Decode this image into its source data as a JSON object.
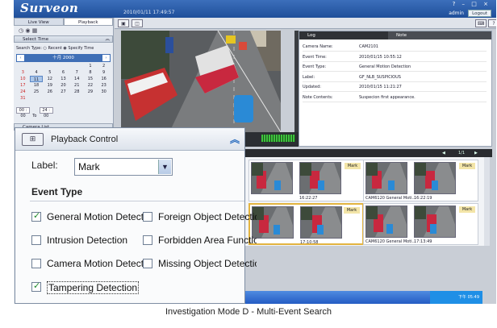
{
  "app": {
    "brand": "Surveon",
    "datetime": "2010/01/11 17:49:57",
    "user": "admin",
    "logout_label": "Logout",
    "window_controls": [
      "?",
      "–",
      "□",
      "×"
    ]
  },
  "sidebar": {
    "tabs": [
      {
        "label": "Live View",
        "active": false
      },
      {
        "label": "Playback",
        "active": true
      }
    ],
    "select_time_label": "Select Time",
    "search_type_label": "Search Type:",
    "search_options": [
      {
        "label": "Recent",
        "selected": false
      },
      {
        "label": "Specify Time",
        "selected": true
      }
    ],
    "calendar": {
      "month_label": "十月 2000",
      "selected_day": "11",
      "weeks": [
        [
          "",
          "",
          "",
          "",
          "",
          "1",
          "2"
        ],
        [
          "3",
          "4",
          "5",
          "6",
          "7",
          "8",
          "9"
        ],
        [
          "10",
          "11",
          "12",
          "13",
          "14",
          "15",
          "16"
        ],
        [
          "17",
          "18",
          "19",
          "20",
          "21",
          "22",
          "23"
        ],
        [
          "24",
          "25",
          "26",
          "27",
          "28",
          "29",
          "30"
        ],
        [
          "31",
          "",
          "",
          "",
          "",
          "",
          ""
        ]
      ]
    },
    "time_from": "00 : 00",
    "time_to_label": "To",
    "time_to": "24 : 00",
    "camera_list_label": "Camera List"
  },
  "log_panel": {
    "tabs": [
      {
        "label": "Log",
        "active": true
      },
      {
        "label": "Note",
        "active": false
      }
    ],
    "rows": [
      {
        "key": "Camera Name:",
        "value": "CAM2101"
      },
      {
        "key": "Event Time:",
        "value": "2010/01/15 10:55:12"
      },
      {
        "key": "Event Type:",
        "value": "General Motion Detection"
      },
      {
        "key": "Label:",
        "value": "GF_NLB_SUSPICIOUS"
      },
      {
        "key": "Updated:",
        "value": "2010/01/15 11:21:27"
      },
      {
        "key": "Note Contents:",
        "value": "Suspecion first appearance."
      }
    ]
  },
  "thumbnails": {
    "page_indicator": "1/1",
    "groups": [
      {
        "mark": "Mark",
        "captions": [
          "",
          "16:22:27"
        ],
        "selected": false
      },
      {
        "mark": "Mark",
        "captions": [
          "CAM6120   General Moti...",
          "16:22:19"
        ],
        "selected": false
      },
      {
        "mark": "Mark",
        "captions": [
          "",
          "17:10:58"
        ],
        "selected": true
      },
      {
        "mark": "Mark",
        "captions": [
          "CAM6120   General Moti...",
          "17:13:49"
        ],
        "selected": false
      }
    ],
    "left_captions": [
      "CAM6120  General Moti...",
      "CAM6120  General Moti..."
    ]
  },
  "taskbar": {
    "clock": "下午 05:49"
  },
  "playback_control": {
    "title": "Playback Control",
    "label_caption": "Label:",
    "label_value": "Mark",
    "event_type_title": "Event Type",
    "options": [
      {
        "label": "General Motion Detection",
        "checked": true
      },
      {
        "label": "Foreign Object Detection",
        "checked": false
      },
      {
        "label": "Intrusion Detection",
        "checked": false
      },
      {
        "label": "Forbidden Area Function",
        "checked": false
      },
      {
        "label": "Camera Motion Detection",
        "checked": false
      },
      {
        "label": "Missing Object Detection",
        "checked": false
      },
      {
        "label": "Tampering Detection",
        "checked": true
      }
    ]
  },
  "caption": "Investigation Mode D - Multi-Event Search"
}
